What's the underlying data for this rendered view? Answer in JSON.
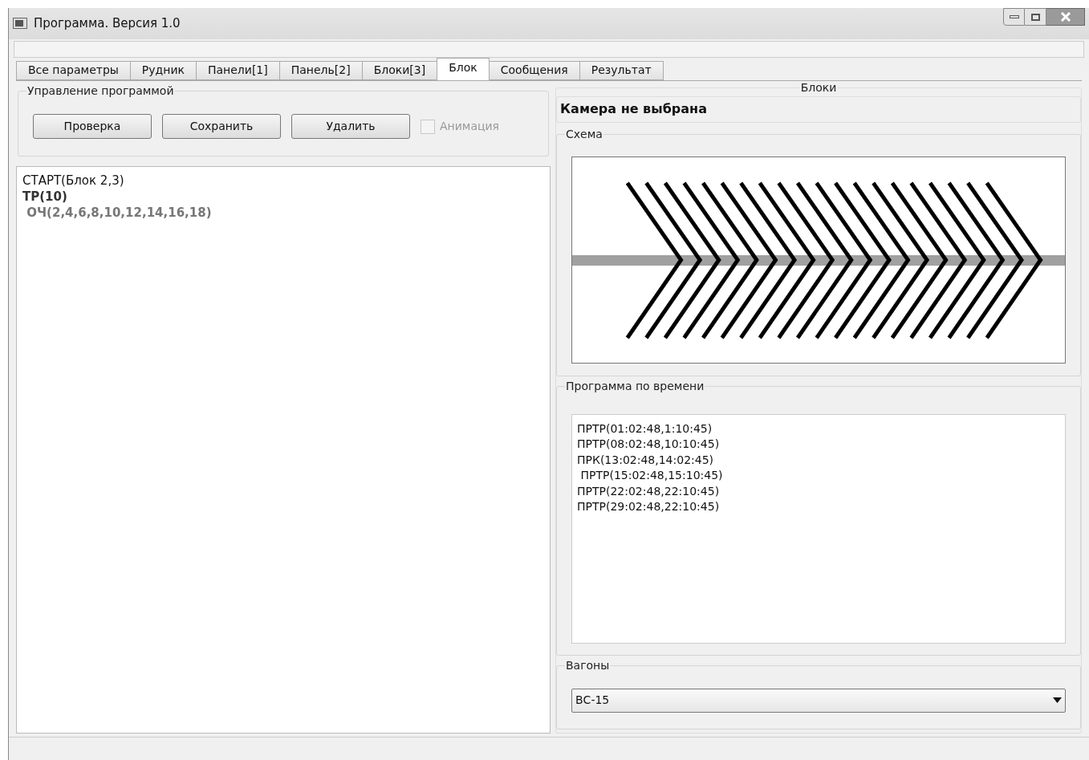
{
  "window": {
    "title": "Программа. Версия 1.0"
  },
  "tabs": [
    {
      "label": "Все параметры",
      "selected": false
    },
    {
      "label": "Рудник",
      "selected": false
    },
    {
      "label": "Панели[1]",
      "selected": false
    },
    {
      "label": "Панель[2]",
      "selected": false
    },
    {
      "label": "Блоки[3]",
      "selected": false
    },
    {
      "label": "Блок",
      "selected": true
    },
    {
      "label": "Сообщения",
      "selected": false
    },
    {
      "label": "Результат",
      "selected": false
    }
  ],
  "control_group": {
    "title": "Управление программой",
    "buttons": [
      "Проверка",
      "Сохранить",
      "Удалить"
    ],
    "animation": {
      "label": "Анимация",
      "checked": false,
      "disabled": true
    }
  },
  "program_lines": [
    {
      "text": "СТАРТ(Блок 2,3)",
      "kind": "plain"
    },
    {
      "text": "ТР(10)",
      "kind": "bold"
    },
    {
      "text": " ОЧ(2,4,6,8,10,12,14,16,18)",
      "kind": "muted"
    }
  ],
  "blocks_panel": {
    "title": "Блоки",
    "camera": "Камера не выбрана",
    "scheme_title": "Схема",
    "schedule_title": "Программа по времени",
    "schedule": [
      "ПРТР(01:02:48,1:10:45)",
      "ПРТР(08:02:48,10:10:45)",
      "ПРК(13:02:48,14:02:45)",
      " ПРТР(15:02:48,15:10:45)",
      "ПРТР(22:02:48,22:10:45)",
      "ПРТР(29:02:48,22:10:45)"
    ],
    "wagons_title": "Вагоны",
    "wagon": "ВС-15"
  }
}
